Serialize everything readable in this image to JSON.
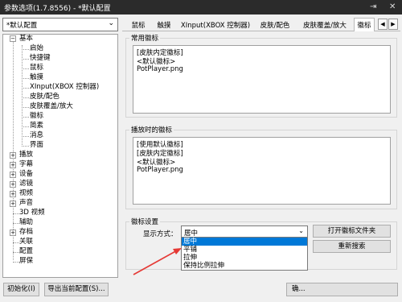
{
  "window": {
    "title": "参数选项(1.7.8556) - *默认配置",
    "pin_icon": "⇥",
    "close_icon": "✕"
  },
  "profile": {
    "value": "*默认配置",
    "arrow": "⌄"
  },
  "tabs": [
    {
      "label": "鼠标"
    },
    {
      "label": "触摸"
    },
    {
      "label": "XInput(XBOX 控制器)"
    },
    {
      "label": "皮肤/配色"
    },
    {
      "label": "皮肤覆盖/放大"
    },
    {
      "label": "徽标",
      "active": true
    }
  ],
  "tab_scroll": {
    "left": "◀",
    "right": "▶"
  },
  "tree": {
    "basic": {
      "label": "基本",
      "expander": "−"
    },
    "basic_children": [
      "启始",
      "快捷键",
      "鼠标",
      "触摸",
      "XInput(XBOX 控制器)",
      "皮肤/配色",
      "皮肤覆盖/放大",
      "徽标",
      "简素",
      "消息",
      "界面"
    ],
    "top_items": [
      {
        "label": "播放",
        "expander": "+"
      },
      {
        "label": "字幕",
        "expander": "+"
      },
      {
        "label": "设备",
        "expander": "+"
      },
      {
        "label": "滤镜",
        "expander": "+"
      },
      {
        "label": "视频",
        "expander": "+"
      },
      {
        "label": "声音",
        "expander": "+"
      },
      {
        "label": "3D 视频",
        "expander": ""
      },
      {
        "label": "辅助",
        "expander": ""
      },
      {
        "label": "存档",
        "expander": "+"
      },
      {
        "label": "关联",
        "expander": ""
      },
      {
        "label": "配置",
        "expander": ""
      },
      {
        "label": "屏保",
        "expander": ""
      }
    ]
  },
  "common_logo": {
    "title": "常用徽标",
    "items": [
      "[皮肤内定徽标]",
      "<默认徽标>",
      "PotPlayer.png"
    ]
  },
  "playing_logo": {
    "title": "播放时的徽标",
    "items": [
      "[使用默认徽标]",
      "[皮肤内定徽标]",
      "<默认徽标>",
      "PotPlayer.png"
    ]
  },
  "logo_settings": {
    "title": "徽标设置",
    "display_label": "显示方式：",
    "display_value": "居中",
    "arrow": "⌄",
    "open_folder_button": "打开徽标文件夹",
    "rescan_button": "重新搜索",
    "dropdown_options": [
      "居中",
      "平铺",
      "拉伸",
      "保持比例拉伸"
    ],
    "highlighted_index": 0
  },
  "footer": {
    "init_button": "初始化(I)",
    "export_button": "导出当前配置(S)...",
    "ok_button": "确..."
  }
}
